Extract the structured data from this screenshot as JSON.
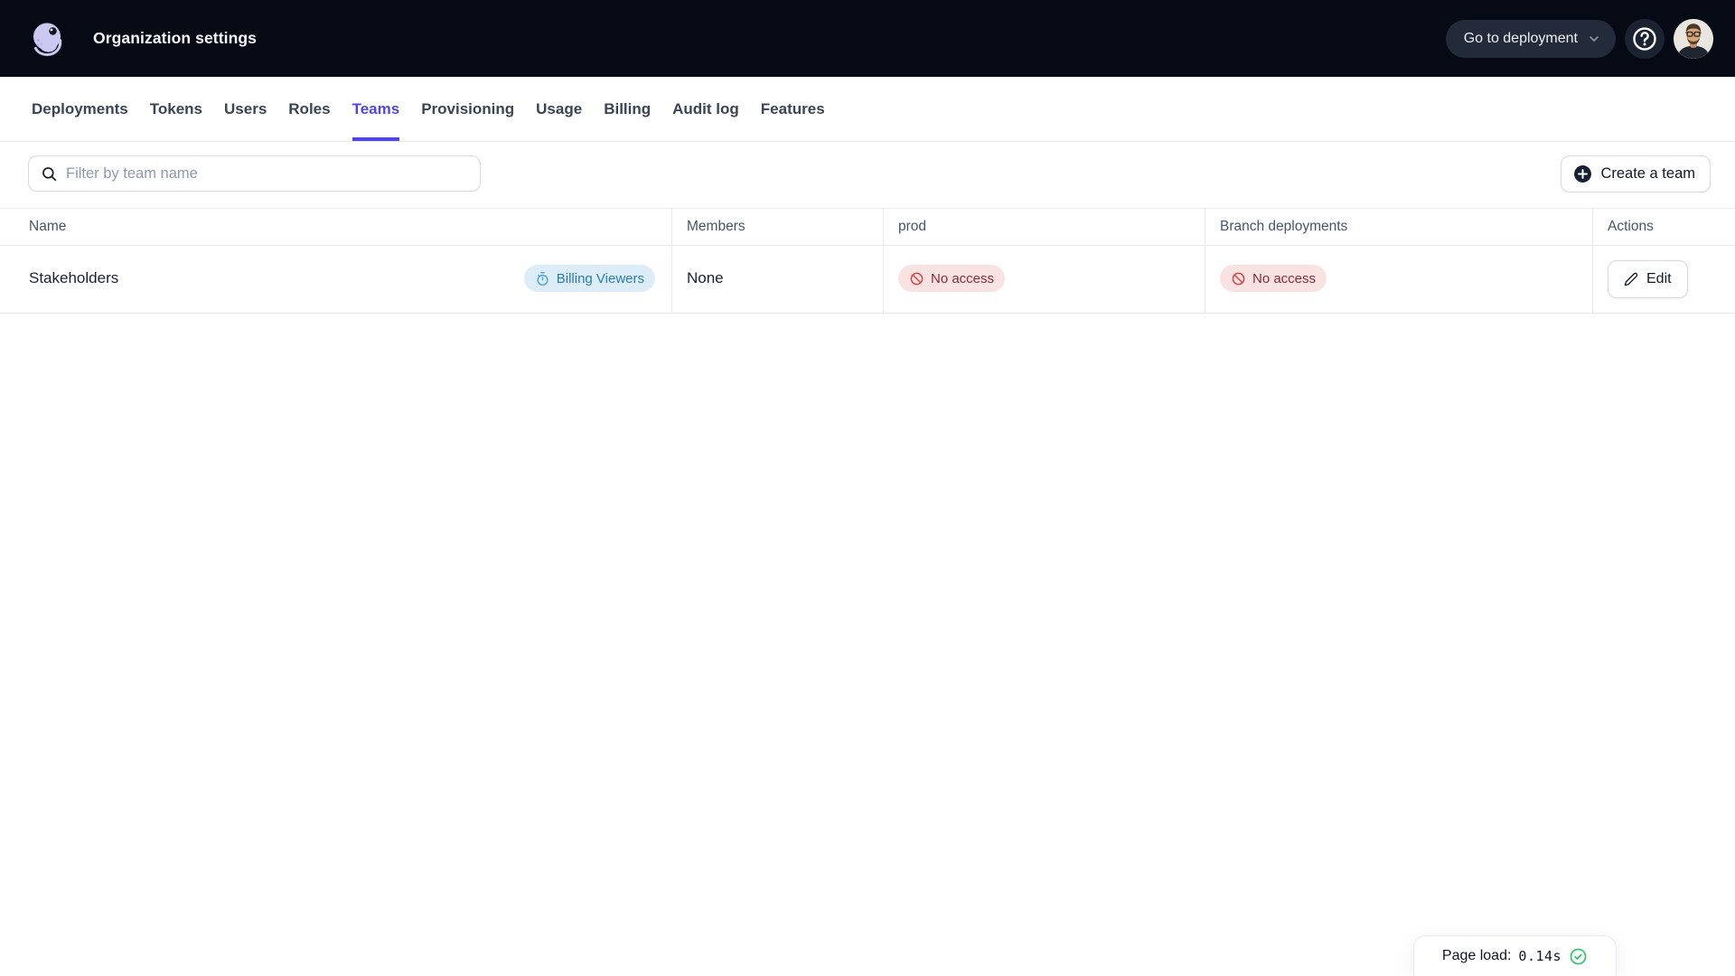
{
  "header": {
    "title": "Organization settings",
    "deployment_button_label": "Go to deployment"
  },
  "nav": {
    "active_tab": "Teams",
    "tabs": [
      "Deployments",
      "Tokens",
      "Users",
      "Roles",
      "Teams",
      "Provisioning",
      "Usage",
      "Billing",
      "Audit log",
      "Features"
    ]
  },
  "toolbar": {
    "filter_placeholder": "Filter by team name",
    "create_team_label": "Create a team"
  },
  "table": {
    "columns": [
      "Name",
      "Members",
      "prod",
      "Branch deployments",
      "Actions"
    ],
    "rows": [
      {
        "name": "Stakeholders",
        "role_badge": "Billing Viewers",
        "members": "None",
        "prod_access": "No access",
        "branch_access": "No access",
        "action_label": "Edit"
      }
    ]
  },
  "status": {
    "page_load_label": "Page load:",
    "page_load_value": "0.14s"
  },
  "icons": {
    "logo": "octopus-logo",
    "badge_blue": "stopwatch-icon",
    "badge_red": "no-access-ban-icon",
    "status": "check-circle-icon"
  },
  "colors": {
    "topbar_bg": "#060a15",
    "accent": "#4f46e5",
    "badge_blue_bg": "#dcedf8",
    "badge_blue_text": "#2a7cae",
    "badge_red_bg": "#f9e2e2",
    "badge_red_text": "#822d36",
    "success_green": "#31c36f"
  }
}
